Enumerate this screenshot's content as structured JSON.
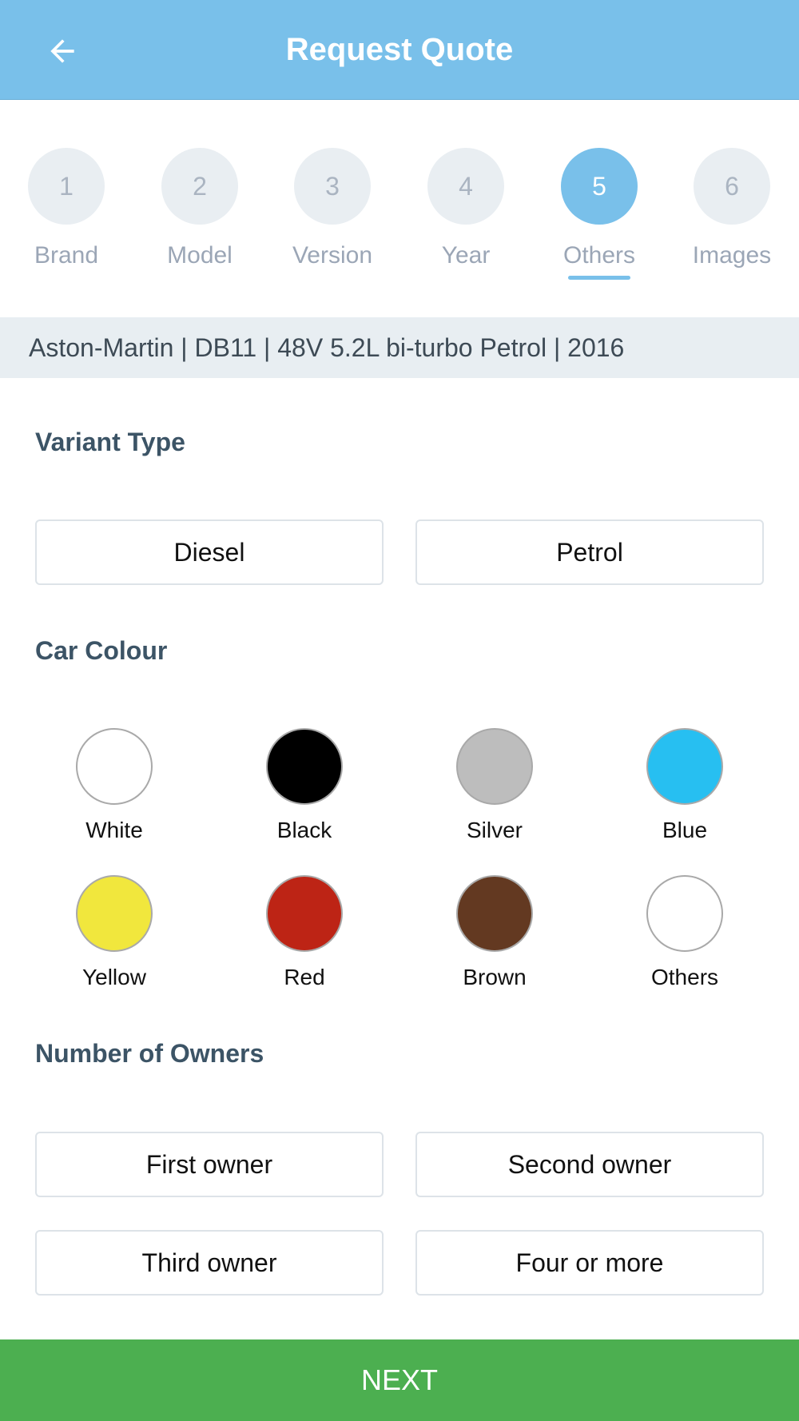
{
  "header": {
    "title": "Request Quote",
    "back_icon": "arrow-left-icon"
  },
  "stepper": {
    "steps": [
      {
        "number": "1",
        "label": "Brand"
      },
      {
        "number": "2",
        "label": "Model"
      },
      {
        "number": "3",
        "label": "Version"
      },
      {
        "number": "4",
        "label": "Year"
      },
      {
        "number": "5",
        "label": "Others"
      },
      {
        "number": "6",
        "label": "Images"
      }
    ],
    "active_step": "5"
  },
  "summary": {
    "text": "Aston-Martin | DB11 | 48V 5.2L bi-turbo Petrol | 2016"
  },
  "variant_type": {
    "title": "Variant Type",
    "options": [
      "Diesel",
      "Petrol"
    ]
  },
  "car_colour": {
    "title": "Car Colour",
    "colours": [
      {
        "label": "White",
        "hex": "#ffffff"
      },
      {
        "label": "Black",
        "hex": "#000000"
      },
      {
        "label": "Silver",
        "hex": "#bdbdbd"
      },
      {
        "label": "Blue",
        "hex": "#27bff1"
      },
      {
        "label": "Yellow",
        "hex": "#f1e73d"
      },
      {
        "label": "Red",
        "hex": "#bd2415"
      },
      {
        "label": "Brown",
        "hex": "#633921"
      },
      {
        "label": "Others",
        "hex": "#ffffff"
      }
    ]
  },
  "owners": {
    "title": "Number of Owners",
    "options": [
      "First owner",
      "Second owner",
      "Third owner",
      "Four or more"
    ]
  },
  "footer": {
    "next_label": "NEXT"
  },
  "colors": {
    "primary": "#79c0ea",
    "accent_green": "#4caf50"
  }
}
